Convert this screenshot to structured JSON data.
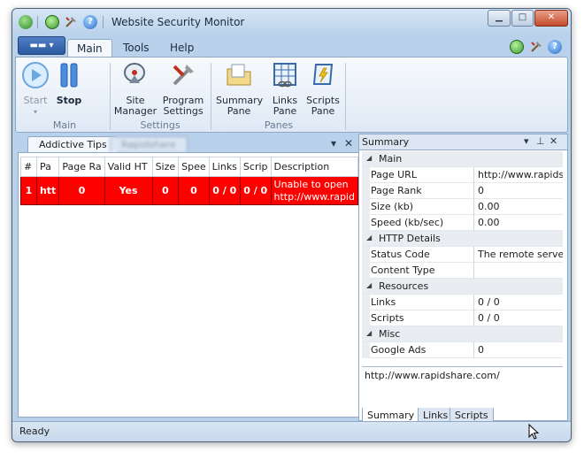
{
  "window": {
    "title": "Website Security Monitor"
  },
  "ribbon": {
    "tabs": [
      "Main",
      "Tools",
      "Help"
    ],
    "buttons": {
      "start": "Start",
      "stop": "Stop",
      "site_manager": [
        "Site",
        "Manager"
      ],
      "program_settings": [
        "Program",
        "Settings"
      ],
      "summary_pane": [
        "Summary",
        "Pane"
      ],
      "links_pane": [
        "Links",
        "Pane"
      ],
      "scripts_pane": [
        "Scripts",
        "Pane"
      ]
    },
    "groups": [
      "Main",
      "Settings",
      "Panes"
    ]
  },
  "doc_tabs": [
    "Addictive Tips",
    "Rapidshare"
  ],
  "grid": {
    "headers": [
      "#",
      "Pa",
      "Page Ra",
      "Valid HT",
      "Size",
      "Spee",
      "Links",
      "Scrip",
      "Description"
    ],
    "rows": [
      {
        "num": "1",
        "page": "htt",
        "rank": "0",
        "valid": "Yes",
        "size": "0",
        "speed": "0",
        "links": "0 / 0",
        "scripts": "0 / 0",
        "desc_1": "Unable to open",
        "desc_2": "http://www.rapid"
      }
    ]
  },
  "summary": {
    "title": "Summary",
    "categories": {
      "main": "Main",
      "http": "HTTP Details",
      "resources": "Resources",
      "misc": "Misc"
    },
    "props": {
      "page_url": [
        "Page URL",
        "http://www.rapidsl"
      ],
      "page_rank": [
        "Page Rank",
        "0"
      ],
      "size": [
        "Size (kb)",
        "0.00"
      ],
      "speed": [
        "Speed (kb/sec)",
        "0.00"
      ],
      "status_code": [
        "Status Code",
        "The remote server"
      ],
      "content_type": [
        "Content Type",
        ""
      ],
      "links": [
        "Links",
        "0 / 0"
      ],
      "scripts": [
        "Scripts",
        "0 / 0"
      ],
      "google_ads": [
        "Google Ads",
        "0"
      ]
    },
    "url": "http://www.rapidshare.com/",
    "bottom_tabs": [
      "Summary",
      "Links",
      "Scripts"
    ]
  },
  "status": {
    "text": "Ready"
  },
  "colors": {
    "error_row": "#ff0000",
    "frame": "#b9d1ea"
  }
}
